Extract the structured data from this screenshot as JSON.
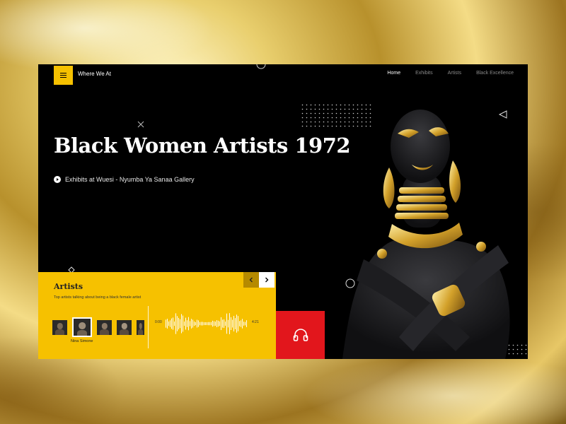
{
  "brand": {
    "name": "Where We At"
  },
  "nav": {
    "items": [
      "Home",
      "Exhibits",
      "Artists",
      "Black Excellence"
    ],
    "active": "Home"
  },
  "hero": {
    "title": "Black Women Artists 1972",
    "exhibit_link": "Exhibits at Wuesi - Nyumba Ya Sanaa Gallery"
  },
  "artists": {
    "title": "Artists",
    "subtitle": "Top artists talking about being a black female artist",
    "selected_name": "Nina Simone",
    "time_start": "0:00",
    "time_end": "4:21"
  },
  "colors": {
    "accent": "#f6c100",
    "listen": "#e2161c",
    "frame": "#000000"
  },
  "icons": [
    "menu-icon",
    "play-icon",
    "chevron-left-icon",
    "chevron-right-icon",
    "headphones-icon"
  ]
}
